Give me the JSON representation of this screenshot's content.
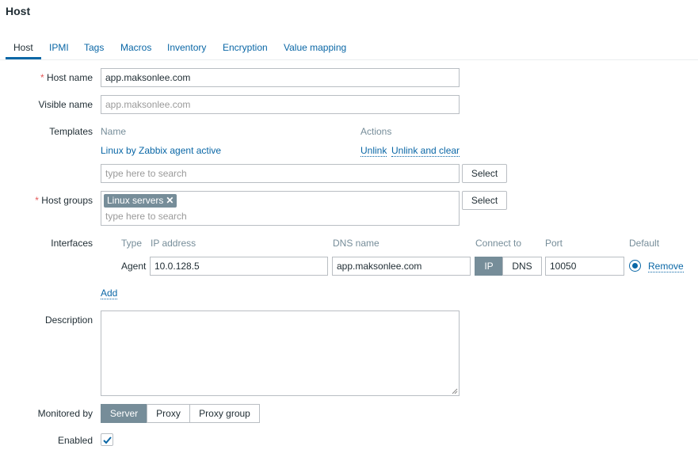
{
  "page": {
    "title": "Host"
  },
  "tabs": [
    {
      "label": "Host"
    },
    {
      "label": "IPMI"
    },
    {
      "label": "Tags"
    },
    {
      "label": "Macros"
    },
    {
      "label": "Inventory"
    },
    {
      "label": "Encryption"
    },
    {
      "label": "Value mapping"
    }
  ],
  "form": {
    "required_mark": "*",
    "host_name": {
      "label": "Host name",
      "value": "app.maksonlee.com"
    },
    "visible_name": {
      "label": "Visible name",
      "placeholder": "app.maksonlee.com"
    },
    "templates": {
      "label": "Templates",
      "col_name": "Name",
      "col_actions": "Actions",
      "items": [
        {
          "name": "Linux by Zabbix agent active",
          "unlink": "Unlink",
          "unlink_clear": "Unlink and clear"
        }
      ],
      "search_placeholder": "type here to search",
      "select_label": "Select"
    },
    "host_groups": {
      "label": "Host groups",
      "chips": [
        {
          "label": "Linux servers",
          "remove": "✕"
        }
      ],
      "search_placeholder": "type here to search",
      "select_label": "Select"
    },
    "interfaces": {
      "label": "Interfaces",
      "headers": {
        "type": "Type",
        "ip": "IP address",
        "dns": "DNS name",
        "connect": "Connect to",
        "port": "Port",
        "default": "Default"
      },
      "rows": [
        {
          "type": "Agent",
          "ip": "10.0.128.5",
          "dns": "app.maksonlee.com",
          "connect_ip": "IP",
          "connect_dns": "DNS",
          "connect_selected": "IP",
          "port": "10050",
          "remove": "Remove"
        }
      ],
      "add_label": "Add"
    },
    "description": {
      "label": "Description",
      "value": ""
    },
    "monitored_by": {
      "label": "Monitored by",
      "options": [
        "Server",
        "Proxy",
        "Proxy group"
      ],
      "selected": "Server"
    },
    "enabled": {
      "label": "Enabled",
      "checked": true
    }
  },
  "colors": {
    "link": "#0a67a6",
    "required": "#e45959",
    "selected_segment": "#768d99",
    "header_text": "#768d99"
  }
}
